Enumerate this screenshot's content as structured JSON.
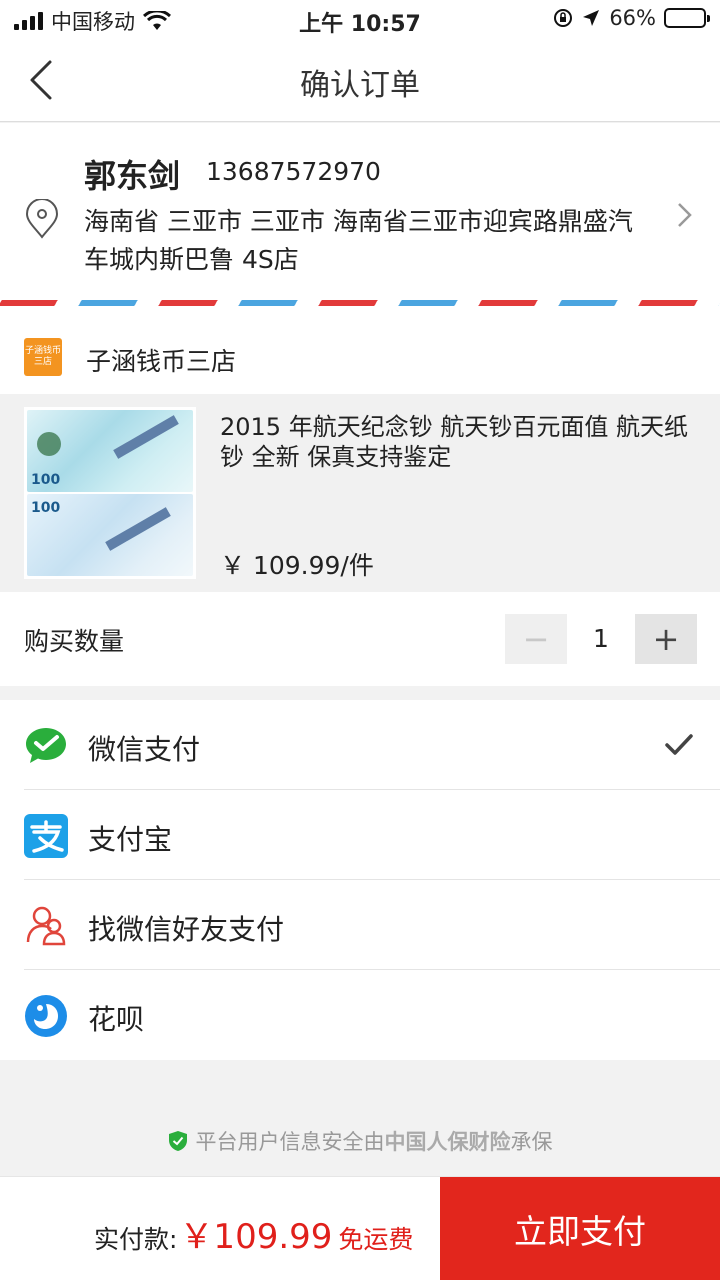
{
  "status_bar": {
    "carrier": "中国移动",
    "time": "上午 10:57",
    "battery_percent": "66%",
    "battery_level": 0.66
  },
  "nav": {
    "title": "确认订单",
    "back_icon": "chevron-left-icon"
  },
  "address": {
    "name": "郭东剑",
    "phone": "13687572970",
    "detail": "海南省 三亚市 三亚市 海南省三亚市迎宾路鼎盛汽车城内斯巴鲁 4S店"
  },
  "shop": {
    "name": "子涵钱币三店",
    "logo_text": "子涵钱币三店"
  },
  "product": {
    "title": "2015 年航天纪念钞 航天钞百元面值 航天纸钞 全新 保真支持鉴定",
    "price": "￥ 109.99/件",
    "note_denomination": "100"
  },
  "quantity": {
    "label": "购买数量",
    "minus": "−",
    "value": "1",
    "plus": "+"
  },
  "payment": {
    "options": [
      {
        "label": "微信支付",
        "icon": "wechat-pay-icon",
        "selected": true
      },
      {
        "label": "支付宝",
        "icon": "alipay-icon",
        "selected": false
      },
      {
        "label": "找微信好友支付",
        "icon": "wechat-friend-icon",
        "selected": false
      },
      {
        "label": "花呗",
        "icon": "huabei-icon",
        "selected": false
      }
    ]
  },
  "notice": {
    "prefix": "平台用户信息安全由",
    "insurer": "中国人保财险",
    "suffix": "承保"
  },
  "footer": {
    "total_label": "实付款:",
    "total_amount": "￥109.99",
    "shipping": "免运费",
    "pay_button": "立即支付"
  },
  "colors": {
    "accent_red": "#e2261d",
    "wechat_green": "#2aae3c",
    "alipay_blue": "#1da1e8"
  }
}
